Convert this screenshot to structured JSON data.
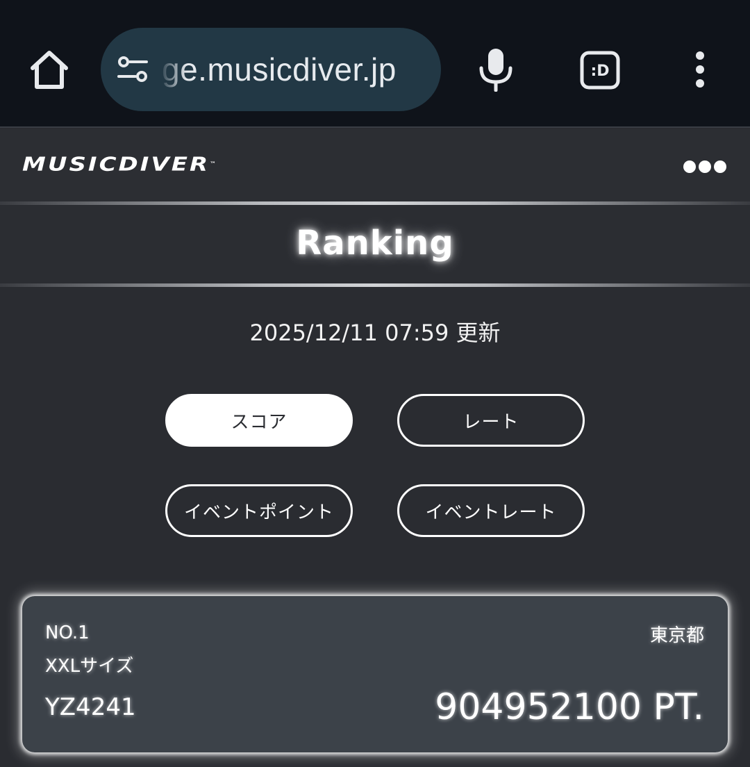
{
  "browser": {
    "url": "ge.musicdiver.jp",
    "icons": {
      "home": "home-icon",
      "site_settings": "tune-icon",
      "voice": "mic-icon",
      "extension": "extension-icon",
      "menu": "more-vertical-icon"
    },
    "extension_label": ":D"
  },
  "site": {
    "logo": "MUSICDIVER",
    "logo_tm": "™",
    "more_icon": "more-horizontal-icon"
  },
  "page": {
    "title": "Ranking",
    "updated": "2025/12/11 07:59 更新"
  },
  "filters": [
    {
      "label": "スコア",
      "active": true
    },
    {
      "label": "レート",
      "active": false
    },
    {
      "label": "イベントポイント",
      "active": false
    },
    {
      "label": "イベントレート",
      "active": false
    }
  ],
  "ranking": [
    {
      "rank": "NO.1",
      "name": "XXLサイズ",
      "prefecture": "東京都",
      "player_id": "YZ4241",
      "score": "904952100 PT."
    }
  ],
  "colors": {
    "browser_bg": "#0f131a",
    "url_pill": "#223845",
    "page_bg": "#2a2c31",
    "card_bg": "#3c4249",
    "accent": "#ffffff"
  }
}
